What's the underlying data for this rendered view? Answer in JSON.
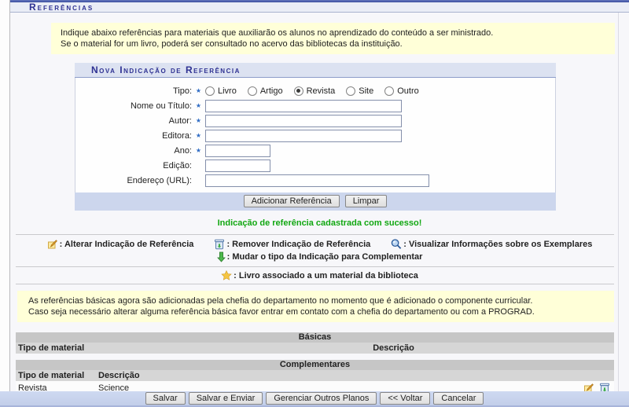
{
  "page_title": "Referências",
  "intro_box": {
    "line1": "Indique abaixo referências para materiais que auxiliarão os alunos no aprendizado do conteúdo a ser ministrado.",
    "line2": "Se o material for um livro, poderá ser consultado no acervo das bibliotecas da instituição."
  },
  "form": {
    "title": "Nova Indicação de Referência",
    "required_marker": "★",
    "fields": {
      "tipo": {
        "label": "Tipo:",
        "required": true
      },
      "nome": {
        "label": "Nome ou Título:",
        "required": true,
        "value": ""
      },
      "autor": {
        "label": "Autor:",
        "required": true,
        "value": ""
      },
      "editora": {
        "label": "Editora:",
        "required": true,
        "value": ""
      },
      "ano": {
        "label": "Ano:",
        "required": true,
        "value": ""
      },
      "edicao": {
        "label": "Edição:",
        "required": false,
        "value": ""
      },
      "url": {
        "label": "Endereço (URL):",
        "required": false,
        "value": ""
      }
    },
    "tipo_options": [
      {
        "label": "Livro",
        "checked": false
      },
      {
        "label": "Artigo",
        "checked": false
      },
      {
        "label": "Revista",
        "checked": true
      },
      {
        "label": "Site",
        "checked": false
      },
      {
        "label": "Outro",
        "checked": false
      }
    ],
    "add_button": "Adicionar Referência",
    "clear_button": "Limpar"
  },
  "success_message": "Indicação de referência cadastrada com sucesso!",
  "legend": {
    "alter_label": "Alterar Indicação de Referência",
    "remove_label": "Remover Indicação de Referência",
    "view_label": "Visualizar Informações sobre os Exemplares",
    "change_type_label": "Mudar o tipo da Indicação para Complementar",
    "star_label": "Livro associado a um material da biblioteca"
  },
  "notice_box": {
    "line1": "As referências básicas agora são adicionadas pela chefia do departamento no momento que é adicionado o componente curricular.",
    "line2": "Caso seja necessário alterar alguma referência básica favor entrar em contato com a chefia do departamento ou com a PROGRAD."
  },
  "tables": {
    "basicas": {
      "title": "Básicas",
      "col_material": "Tipo de material",
      "col_descricao": "Descrição"
    },
    "complementares": {
      "title": "Complementares",
      "col_material": "Tipo de material",
      "col_descricao": "Descrição",
      "rows": [
        {
          "material": "Revista",
          "descricao": "Science"
        }
      ]
    }
  },
  "footer": {
    "buttons": [
      "Salvar",
      "Salvar e Enviar",
      "Gerenciar Outros Planos",
      "<< Voltar",
      "Cancelar"
    ]
  },
  "colors": {
    "title_text": "#2e3192",
    "success_text": "#11a711",
    "required_star": "#2f6cc4",
    "info_bg": "#ffffd8",
    "form_header_bg": "#dce2f1",
    "bar_bg": "#c9d4ee"
  }
}
